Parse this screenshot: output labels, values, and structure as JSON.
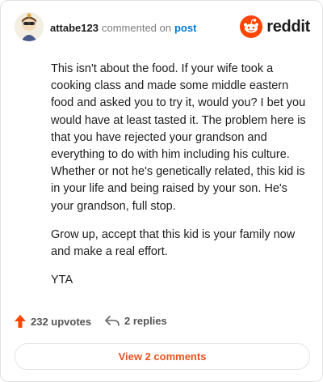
{
  "comment": {
    "username": "attabe123",
    "action": "commented on",
    "post_link": "post",
    "paragraphs": [
      "This isn't about the food. If your wife took a cooking class and made some middle eastern food and asked you to try it, would you? I bet you would have at least tasted it. The problem here is that you have rejected your grandson and everything to do with him including his culture. Whether or not he's genetically related, this kid is in your life and being raised by your son. He's your grandson, full stop.",
      "Grow up, accept that this kid is your family now and make a real effort.",
      "YTA"
    ]
  },
  "brand": {
    "name": "reddit",
    "color": "#ff4500",
    "icon": "reddit-snoo-icon"
  },
  "footer": {
    "upvotes": "232 upvotes",
    "replies": "2 replies",
    "view_comments": "View 2 comments",
    "upvote_color": "#ff4500",
    "link_color": "#e8541d"
  }
}
